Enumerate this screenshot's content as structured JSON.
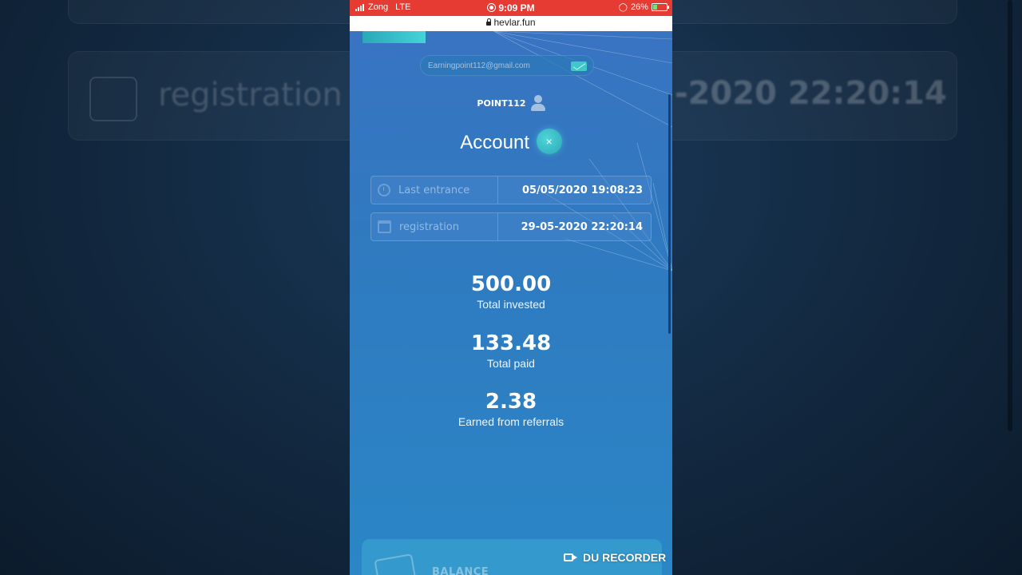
{
  "status_bar": {
    "carrier": "Zong",
    "network": "LTE",
    "time": "9:09 PM",
    "battery": "26%"
  },
  "browser": {
    "url": "hevlar.fun"
  },
  "account": {
    "email_placeholder": "Earningpoint112@gmail.com",
    "username": "POINT112",
    "title": "Account",
    "close_symbol": "×",
    "last_entrance_label": "Last entrance",
    "last_entrance_value": "05/05/2020 19:08:23",
    "registration_label": "registration",
    "registration_value": "29-05-2020 22:20:14"
  },
  "stats": {
    "total_invested_value": "500.00",
    "total_invested_label": "Total invested",
    "total_paid_value": "133.48",
    "total_paid_label": "Total paid",
    "referrals_value": "2.38",
    "referrals_label": "Earned from referrals"
  },
  "balance": {
    "label": "BALANCE"
  },
  "overlay": {
    "recorder_label": "DU RECORDER"
  },
  "background": {
    "registration_text": "registration",
    "date_text": "-2020 22:20:14"
  },
  "colors": {
    "status_bar": "#e63b33",
    "accent_teal": "#3fc7c9",
    "page_blue": "#2f7ac0"
  }
}
